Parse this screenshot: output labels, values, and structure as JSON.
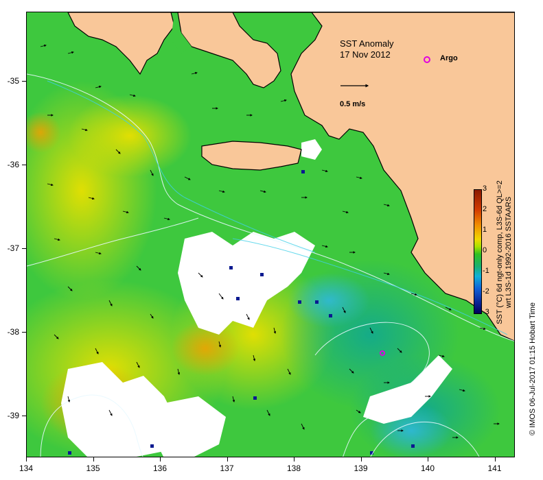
{
  "title": {
    "line1": "SST Anomaly",
    "line2": "17 Nov 2012"
  },
  "legend": {
    "argo_label": "Argo",
    "argo_color": "#e000e0",
    "scale_label": "0.5 m/s"
  },
  "axes": {
    "x_ticks": [
      "134",
      "135",
      "136",
      "137",
      "138",
      "139",
      "140",
      "141"
    ],
    "y_ticks": [
      "-35",
      "-36",
      "-37",
      "-38",
      "-39"
    ]
  },
  "colorbar": {
    "ticks": [
      "3",
      "2",
      "1",
      "0",
      "-1",
      "-2",
      "-3"
    ],
    "caption_line1": "SST (°C) 6d ngt-only comp, L3S-6d QL>=2",
    "caption_line2": "wrt L3S-1d 1992-2016 SSTAARS"
  },
  "credit": "© IMOS 06-Jul-2017 01:15 Hobart Time",
  "colors": {
    "land": "#f9c799",
    "ocean_green": "#3cc43c",
    "anomaly_warm": "#e8d800",
    "contour": "#e8f8ff",
    "missing": "#ffffff"
  }
}
